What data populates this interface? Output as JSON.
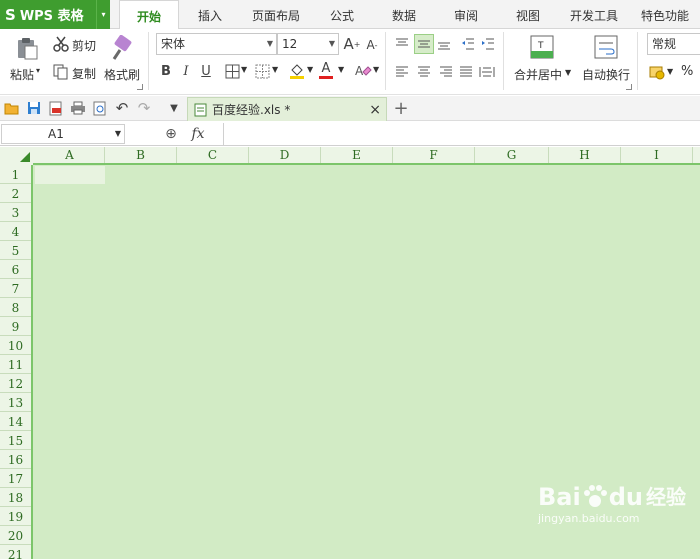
{
  "app": {
    "logo": "S",
    "name": "WPS 表格",
    "menu_arrow": "▾"
  },
  "tabs": [
    {
      "label": "开始",
      "active": true
    },
    {
      "label": "插入"
    },
    {
      "label": "页面布局"
    },
    {
      "label": "公式"
    },
    {
      "label": "数据"
    },
    {
      "label": "审阅"
    },
    {
      "label": "视图"
    },
    {
      "label": "开发工具"
    },
    {
      "label": "特色功能"
    }
  ],
  "ribbon": {
    "paste": "粘贴",
    "cut": "剪切",
    "copy": "复制",
    "format_painter": "格式刷",
    "font_name": "宋体",
    "font_size": "12",
    "bold": "B",
    "italic": "I",
    "underline": "U",
    "font_color_glyph": "A",
    "merge_center": "合并居中",
    "wrap_text": "自动换行",
    "number_format": "常规",
    "percent": "%"
  },
  "document": {
    "tab_name": "百度经验.xls *",
    "close": "×",
    "new_tab": "+"
  },
  "formula_bar": {
    "name_box": "A1",
    "fx": "fx",
    "zoom_glyph": "⊕",
    "formula": ""
  },
  "sheet": {
    "columns": [
      "A",
      "B",
      "C",
      "D",
      "E",
      "F",
      "G",
      "H",
      "I"
    ],
    "rows": [
      "1",
      "2",
      "3",
      "4",
      "5",
      "6",
      "7",
      "8",
      "9",
      "10",
      "11",
      "12",
      "13",
      "14",
      "15",
      "16",
      "17",
      "18",
      "19",
      "20",
      "21"
    ],
    "active_cell": "A1"
  },
  "watermark": {
    "brand": "Bai",
    "brand2": "du",
    "suffix": "经验",
    "url": "jingyan.baidu.com"
  },
  "colors": {
    "accent": "#3f9d2f",
    "grid_bg": "#d2ebc5",
    "header_bg": "#ecf5e6"
  }
}
